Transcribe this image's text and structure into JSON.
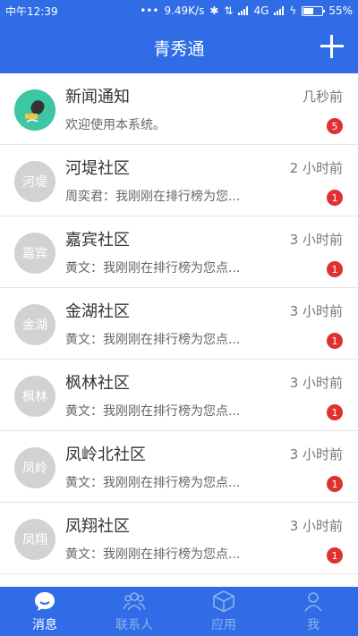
{
  "status_bar": {
    "time": "中午12:39",
    "speed": "9.49K/s",
    "network": "4G",
    "battery": "55%",
    "battery_level": 0.55
  },
  "header": {
    "title": "青秀通"
  },
  "conversations": [
    {
      "avatar": "",
      "name": "新闻通知",
      "time": "几秒前",
      "preview": "欢迎使用本系统。",
      "badge": "5"
    },
    {
      "avatar": "河堤",
      "name": "河堤社区",
      "time": "2 小时前",
      "preview": "周奕君：我刚刚在排行榜为您...",
      "badge": "1"
    },
    {
      "avatar": "嘉宾",
      "name": "嘉宾社区",
      "time": "3 小时前",
      "preview": "黄文：我刚刚在排行榜为您点...",
      "badge": "1"
    },
    {
      "avatar": "金湖",
      "name": "金湖社区",
      "time": "3 小时前",
      "preview": "黄文：我刚刚在排行榜为您点...",
      "badge": "1"
    },
    {
      "avatar": "枫林",
      "name": "枫林社区",
      "time": "3 小时前",
      "preview": "黄文：我刚刚在排行榜为您点...",
      "badge": "1"
    },
    {
      "avatar": "凤岭",
      "name": "凤岭北社区",
      "time": "3 小时前",
      "preview": "黄文：我刚刚在排行榜为您点...",
      "badge": "1"
    },
    {
      "avatar": "凤翔",
      "name": "凤翔社区",
      "time": "3 小时前",
      "preview": "黄文：我刚刚在排行榜为您点...",
      "badge": "1"
    }
  ],
  "tabs": [
    {
      "label": "消息",
      "icon": "chat-bubble-icon",
      "active": true
    },
    {
      "label": "联系人",
      "icon": "contacts-icon",
      "active": false
    },
    {
      "label": "应用",
      "icon": "cube-icon",
      "active": false
    },
    {
      "label": "我",
      "icon": "person-icon",
      "active": false
    }
  ],
  "colors": {
    "primary": "#2f6ce5",
    "badge": "#e03131",
    "avatar_gray": "#d2d2d2",
    "news_avatar": "#3cc6a3"
  }
}
